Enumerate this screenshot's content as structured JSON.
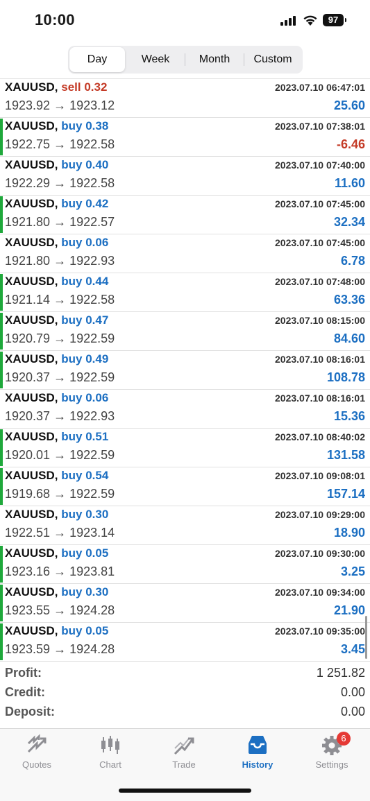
{
  "status_bar": {
    "time": "10:00",
    "battery": "97"
  },
  "period_tabs": [
    {
      "label": "Day",
      "active": true
    },
    {
      "label": "Week",
      "active": false
    },
    {
      "label": "Month",
      "active": false
    },
    {
      "label": "Custom",
      "active": false
    }
  ],
  "deals": [
    {
      "symbol": "XAUUSD,",
      "side": "sell",
      "volume": "0.32",
      "time": "2023.07.10 06:47:01",
      "open": "1923.92",
      "close": "1923.12",
      "profit": "25.60",
      "profit_sign": "pos",
      "win_marker": false
    },
    {
      "symbol": "XAUUSD,",
      "side": "buy",
      "volume": "0.38",
      "time": "2023.07.10 07:38:01",
      "open": "1922.75",
      "close": "1922.58",
      "profit": "-6.46",
      "profit_sign": "neg",
      "win_marker": true
    },
    {
      "symbol": "XAUUSD,",
      "side": "buy",
      "volume": "0.40",
      "time": "2023.07.10 07:40:00",
      "open": "1922.29",
      "close": "1922.58",
      "profit": "11.60",
      "profit_sign": "pos",
      "win_marker": false
    },
    {
      "symbol": "XAUUSD,",
      "side": "buy",
      "volume": "0.42",
      "time": "2023.07.10 07:45:00",
      "open": "1921.80",
      "close": "1922.57",
      "profit": "32.34",
      "profit_sign": "pos",
      "win_marker": true
    },
    {
      "symbol": "XAUUSD,",
      "side": "buy",
      "volume": "0.06",
      "time": "2023.07.10 07:45:00",
      "open": "1921.80",
      "close": "1922.93",
      "profit": "6.78",
      "profit_sign": "pos",
      "win_marker": false
    },
    {
      "symbol": "XAUUSD,",
      "side": "buy",
      "volume": "0.44",
      "time": "2023.07.10 07:48:00",
      "open": "1921.14",
      "close": "1922.58",
      "profit": "63.36",
      "profit_sign": "pos",
      "win_marker": true
    },
    {
      "symbol": "XAUUSD,",
      "side": "buy",
      "volume": "0.47",
      "time": "2023.07.10 08:15:00",
      "open": "1920.79",
      "close": "1922.59",
      "profit": "84.60",
      "profit_sign": "pos",
      "win_marker": true
    },
    {
      "symbol": "XAUUSD,",
      "side": "buy",
      "volume": "0.49",
      "time": "2023.07.10 08:16:01",
      "open": "1920.37",
      "close": "1922.59",
      "profit": "108.78",
      "profit_sign": "pos",
      "win_marker": true
    },
    {
      "symbol": "XAUUSD,",
      "side": "buy",
      "volume": "0.06",
      "time": "2023.07.10 08:16:01",
      "open": "1920.37",
      "close": "1922.93",
      "profit": "15.36",
      "profit_sign": "pos",
      "win_marker": false
    },
    {
      "symbol": "XAUUSD,",
      "side": "buy",
      "volume": "0.51",
      "time": "2023.07.10 08:40:02",
      "open": "1920.01",
      "close": "1922.59",
      "profit": "131.58",
      "profit_sign": "pos",
      "win_marker": true
    },
    {
      "symbol": "XAUUSD,",
      "side": "buy",
      "volume": "0.54",
      "time": "2023.07.10 09:08:01",
      "open": "1919.68",
      "close": "1922.59",
      "profit": "157.14",
      "profit_sign": "pos",
      "win_marker": true
    },
    {
      "symbol": "XAUUSD,",
      "side": "buy",
      "volume": "0.30",
      "time": "2023.07.10 09:29:00",
      "open": "1922.51",
      "close": "1923.14",
      "profit": "18.90",
      "profit_sign": "pos",
      "win_marker": false
    },
    {
      "symbol": "XAUUSD,",
      "side": "buy",
      "volume": "0.05",
      "time": "2023.07.10 09:30:00",
      "open": "1923.16",
      "close": "1923.81",
      "profit": "3.25",
      "profit_sign": "pos",
      "win_marker": true
    },
    {
      "symbol": "XAUUSD,",
      "side": "buy",
      "volume": "0.30",
      "time": "2023.07.10 09:34:00",
      "open": "1923.55",
      "close": "1924.28",
      "profit": "21.90",
      "profit_sign": "pos",
      "win_marker": true
    },
    {
      "symbol": "XAUUSD,",
      "side": "buy",
      "volume": "0.05",
      "time": "2023.07.10 09:35:00",
      "open": "1923.59",
      "close": "1924.28",
      "profit": "3.45",
      "profit_sign": "pos",
      "win_marker": true
    }
  ],
  "summary": [
    {
      "label": "Profit:",
      "value": "1 251.82"
    },
    {
      "label": "Credit:",
      "value": "0.00"
    },
    {
      "label": "Deposit:",
      "value": "0.00"
    }
  ],
  "tab_bar": {
    "items": [
      {
        "label": "Quotes",
        "icon": "quotes-icon"
      },
      {
        "label": "Chart",
        "icon": "chart-icon"
      },
      {
        "label": "Trade",
        "icon": "trade-icon"
      },
      {
        "label": "History",
        "icon": "history-icon",
        "active": true
      },
      {
        "label": "Settings",
        "icon": "settings-icon",
        "badge": "6"
      }
    ]
  },
  "colors": {
    "sell": "#c43a26",
    "buy": "#1c6fc2",
    "profit_positive": "#1c6fc2",
    "profit_negative": "#c43a26",
    "win_marker": "#1fa83b",
    "active_tab": "#1c6fc2",
    "badge": "#e53935"
  }
}
